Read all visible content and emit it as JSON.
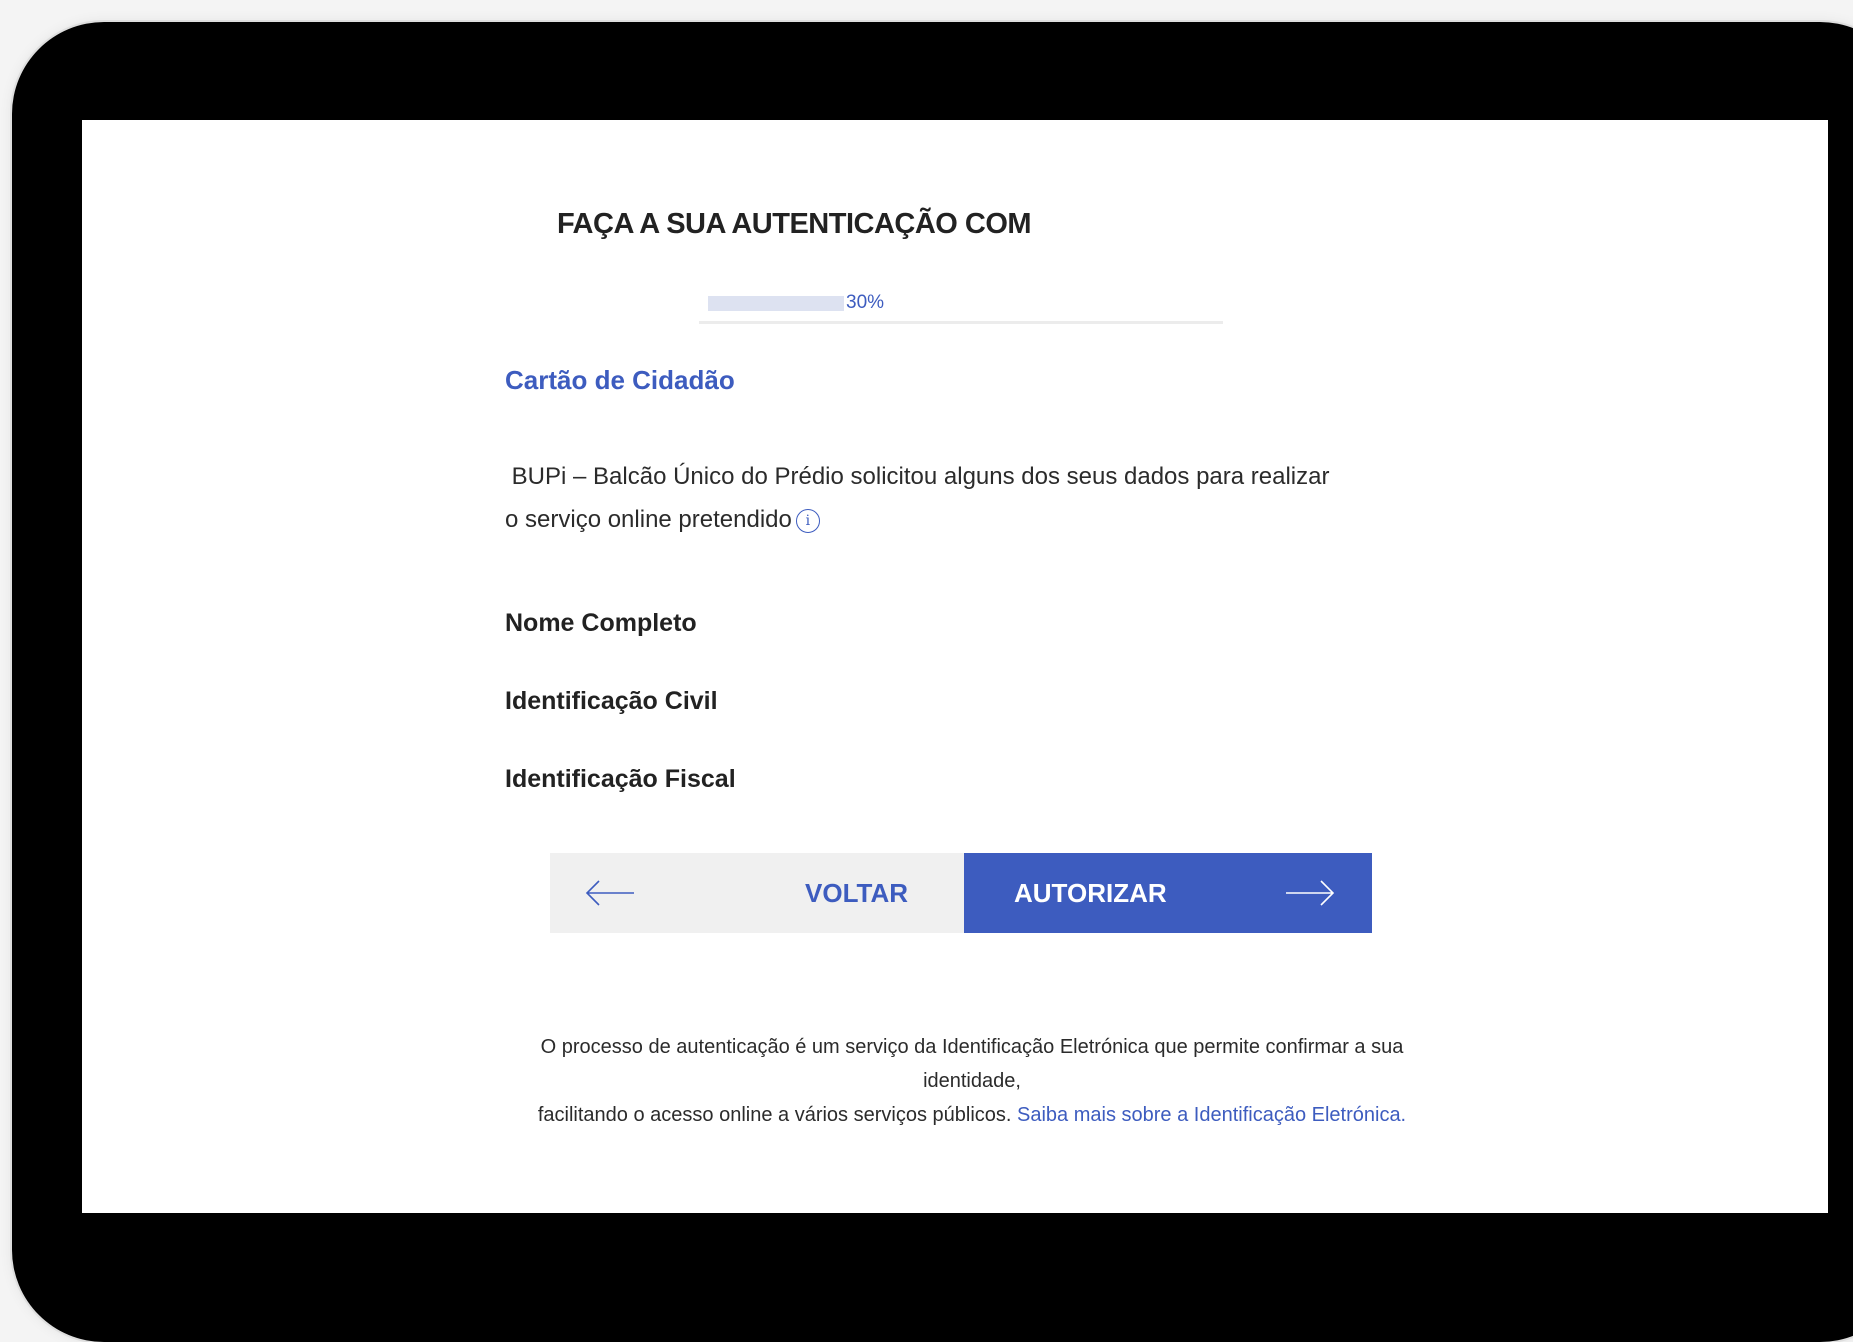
{
  "page": {
    "title": "FAÇA A SUA AUTENTICAÇÃO COM",
    "progress": {
      "value": 0.3,
      "label": "30%"
    },
    "section_title": "Cartão de Cidadão",
    "description_line1": " BUPi – Balcão Único do Prédio solicitou alguns dos seus dados para realizar",
    "description_line2": "o serviço online pretendido",
    "info_icon_glyph": "i",
    "fields": [
      "Nome Completo",
      "Identificação Civil",
      "Identificação Fiscal"
    ],
    "buttons": {
      "back_label": "VOLTAR",
      "authorize_label": "AUTORIZAR"
    },
    "footer": {
      "line1": "O processo de autenticação é um serviço da Identificação Eletrónica que permite confirmar a sua identidade,",
      "line2": "facilitando o acesso online a vários serviços públicos.",
      "link_text": "Saiba mais sobre a Identificação Eletrónica."
    }
  },
  "colors": {
    "accent": "#3d5cbf",
    "button_back_bg": "#f0f0f0",
    "progress_fill": "#dde2f1",
    "device_bezel": "#000000"
  },
  "icons": [
    "arrow-left-icon",
    "arrow-right-icon",
    "info-icon"
  ]
}
